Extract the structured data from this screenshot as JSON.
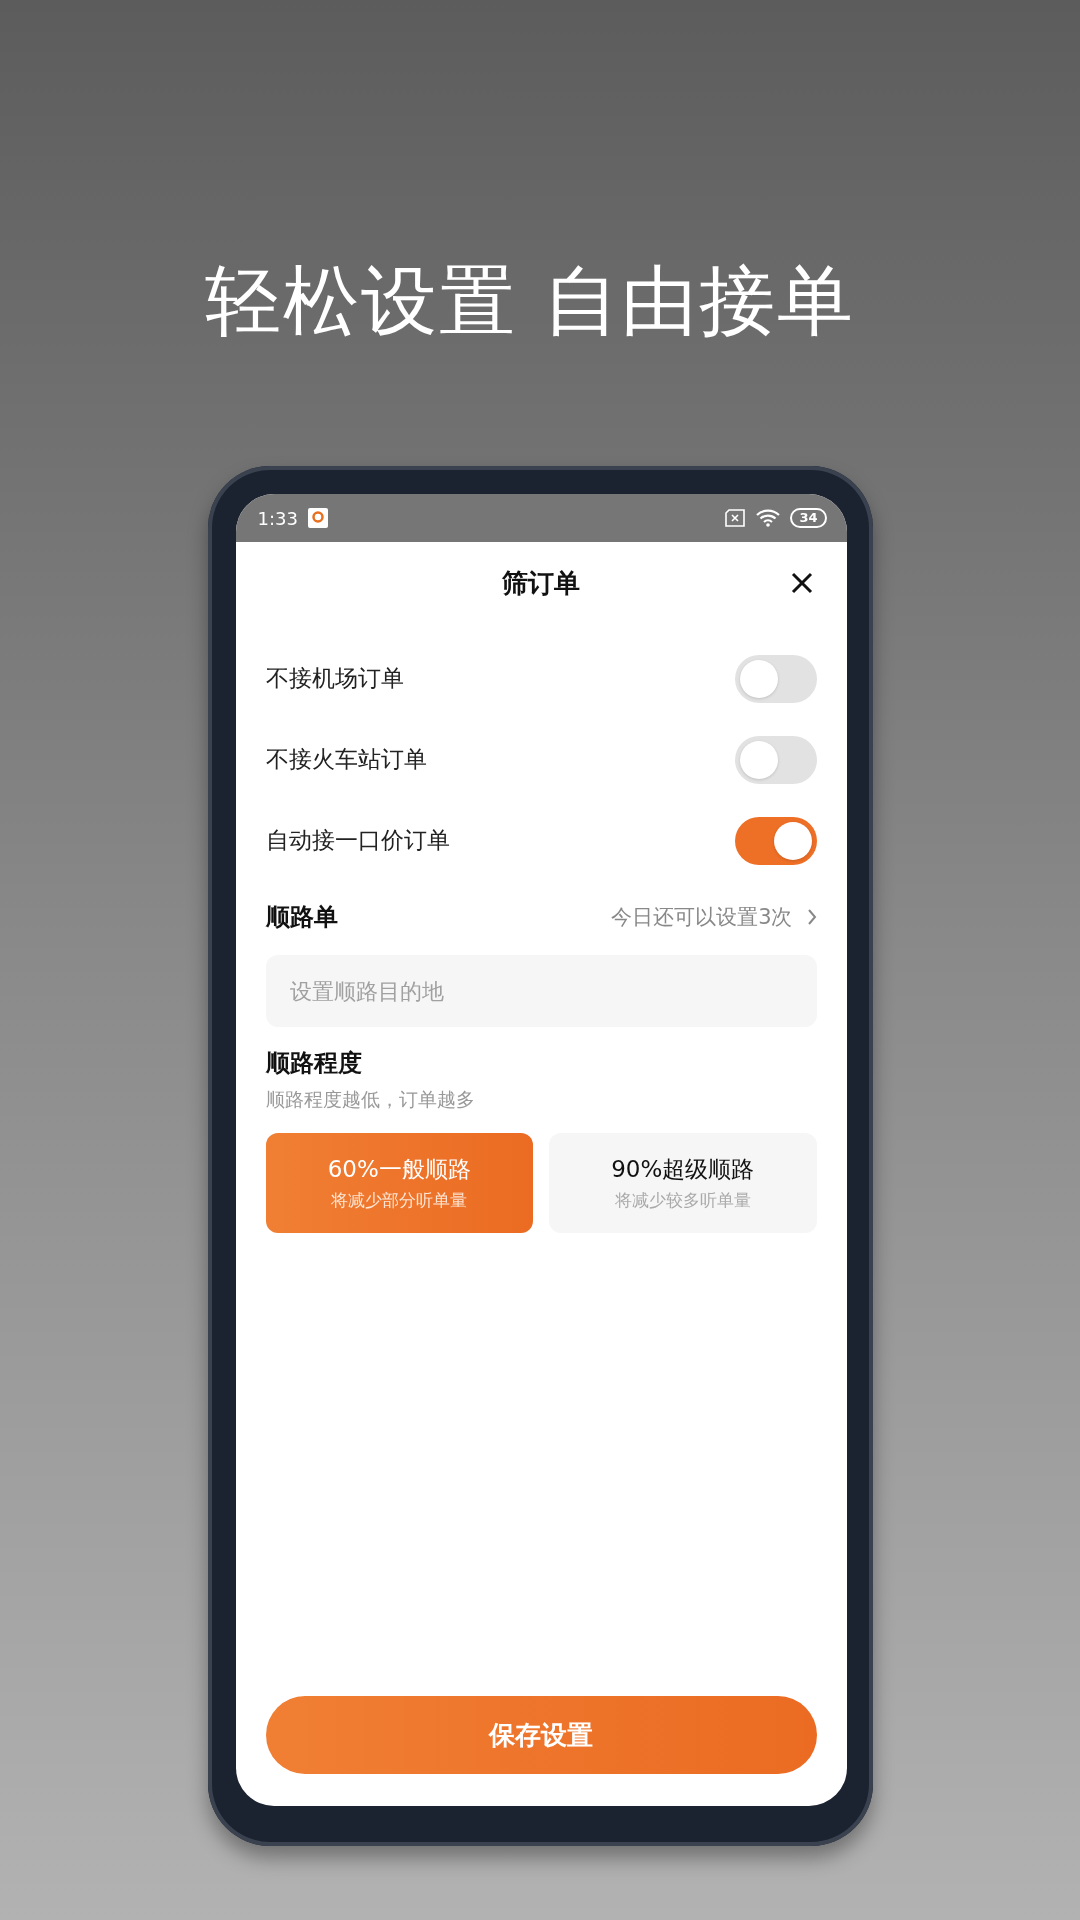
{
  "headline": "轻松设置 自由接单",
  "status_bar": {
    "time": "1:33",
    "battery": "34"
  },
  "header": {
    "title": "筛订单"
  },
  "toggles": [
    {
      "label": "不接机场订单",
      "on": false
    },
    {
      "label": "不接火车站订单",
      "on": false
    },
    {
      "label": "自动接一口价订单",
      "on": true
    }
  ],
  "route_order": {
    "title": "顺路单",
    "hint": "今日还可以设置3次",
    "placeholder": "设置顺路目的地"
  },
  "route_degree": {
    "title": "顺路程度",
    "subtitle": "顺路程度越低，订单越多",
    "options": [
      {
        "title": "60%一般顺路",
        "note": "将减少部分听单量",
        "selected": true
      },
      {
        "title": "90%超级顺路",
        "note": "将减少较多听单量",
        "selected": false
      }
    ]
  },
  "save_button": "保存设置"
}
